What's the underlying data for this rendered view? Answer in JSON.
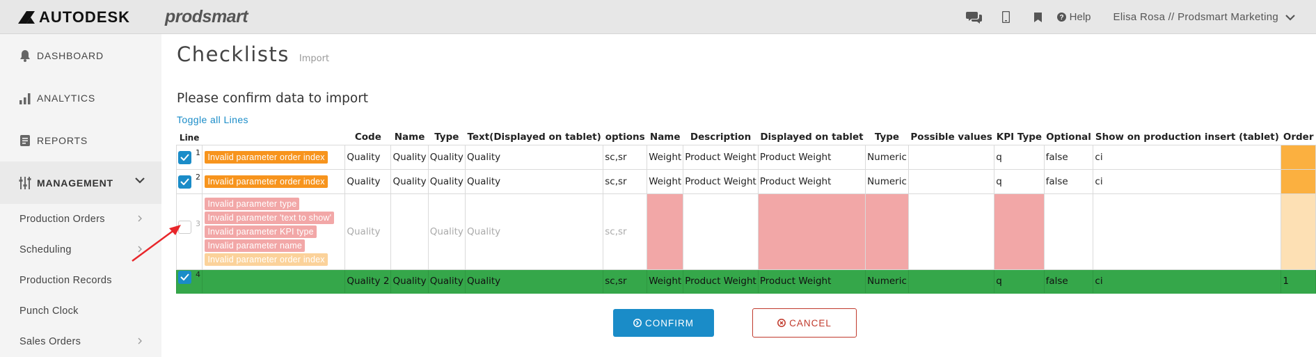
{
  "brand": {
    "autodesk": "AUTODESK",
    "prodsmart": "prodsmart"
  },
  "topbar": {
    "icons": [
      "chat-icon",
      "mobile-icon",
      "bookmark-icon"
    ],
    "help": "Help",
    "user": "Elisa Rosa // Prodsmart Marketing"
  },
  "sidebar": {
    "dashboard": "DASHBOARD",
    "analytics": "ANALYTICS",
    "reports": "REPORTS",
    "management": "MANAGEMENT",
    "sub": [
      "Production Orders",
      "Scheduling",
      "Production Records",
      "Punch Clock",
      "Sales Orders"
    ]
  },
  "page": {
    "title": "Checklists",
    "subtitle": "Import",
    "confirm_title": "Please confirm data to import",
    "toggle": "Toggle all Lines"
  },
  "table": {
    "headers": [
      "Line",
      "",
      "Code",
      "Name",
      "Type",
      "Text(Displayed on tablet)",
      "options",
      "Name",
      "Description",
      "Displayed on tablet",
      "Type",
      "Possible values",
      "KPI Type",
      "Optional",
      "Show on production insert (tablet)",
      "Order"
    ],
    "rows": [
      {
        "line": "1",
        "checked": true,
        "errors": [
          "Invalid parameter order index"
        ],
        "cells": [
          "Quality",
          "Quality",
          "Quality",
          "Quality",
          "sc,sr",
          "Weight",
          "Product Weight",
          "Product Weight",
          "Numeric",
          "",
          "q",
          "false",
          "ci",
          ""
        ]
      },
      {
        "line": "2",
        "checked": true,
        "errors": [
          "Invalid parameter order index"
        ],
        "cells": [
          "Quality",
          "Quality",
          "Quality",
          "Quality",
          "sc,sr",
          "Weight",
          "Product Weight",
          "Product Weight",
          "Numeric",
          "",
          "q",
          "false",
          "ci",
          ""
        ]
      },
      {
        "line": "3",
        "checked": false,
        "errors": [
          "Invalid parameter type",
          "Invalid parameter 'text to show'",
          "Invalid parameter KPI type",
          "Invalid parameter name",
          "Invalid parameter order index"
        ],
        "cells": [
          "Quality",
          "",
          "Quality",
          "Quality",
          "sc,sr",
          "",
          "",
          "",
          "",
          "",
          "",
          "",
          "",
          ""
        ]
      },
      {
        "line": "4",
        "checked": true,
        "errors": [],
        "cells": [
          "Quality 2",
          "Quality",
          "Quality",
          "Quality",
          "sc,sr",
          "Weight",
          "Product Weight",
          "Product Weight",
          "Numeric",
          "",
          "q",
          "false",
          "ci",
          "1"
        ]
      }
    ]
  },
  "buttons": {
    "confirm": "CONFIRM",
    "cancel": "CANCEL"
  },
  "colors": {
    "accent": "#1a8cc8",
    "valid_row": "#35a74a",
    "error_cell": "#f2a7a7",
    "warning": "#f7941d",
    "cancel": "#c0392b"
  }
}
